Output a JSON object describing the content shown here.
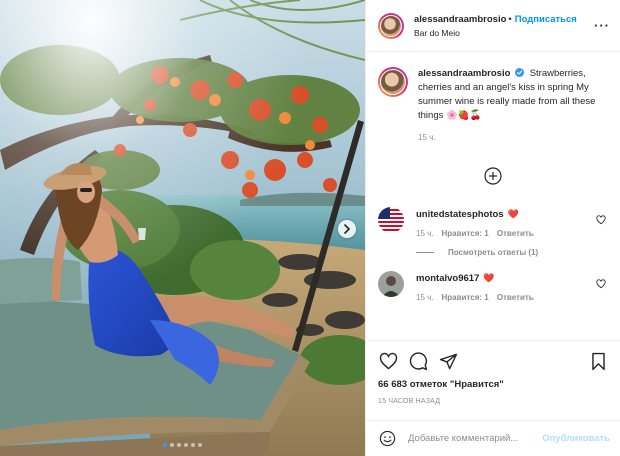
{
  "header": {
    "username": "alessandraambrosio",
    "follow_dot": "•",
    "follow_label": "Подписаться",
    "location": "Bar do Meio"
  },
  "caption": {
    "username": "alessandraambrosio",
    "text": "Strawberries, cherries and an angel's kiss in spring My summer wine is really made from all these things 🌸🍓🍒",
    "time": "15 ч."
  },
  "comments": [
    {
      "username": "unitedstatesphotos",
      "emoji": "❤️",
      "time": "15 ч.",
      "likes": "Нравится: 1",
      "reply": "Ответить",
      "view_replies": "Посмотреть ответы (1)"
    },
    {
      "username": "montalvo9617",
      "emoji": "❤️",
      "time": "15 ч.",
      "likes": "Нравится: 1",
      "reply": "Ответить"
    }
  ],
  "stats": {
    "likes": "66 683 отметок \"Нравится\"",
    "time_ago": "15 ЧАСОВ НАЗАД"
  },
  "add_comment": {
    "placeholder": "Добавьте комментарий...",
    "publish_label": "Опубликовать"
  },
  "carousel": {
    "slide_count": 6,
    "active_index": 0
  },
  "colors": {
    "accent": "#0095f6",
    "publish_disabled": "#b2dffc",
    "muted": "#8e8e8e",
    "text": "#262626",
    "carousel_active_dot": "#3897f0"
  },
  "icons": {
    "more": "more-horizontal-icon",
    "verified": "verified-badge-icon",
    "load_more": "plus-circle-icon",
    "like": "heart-outline-icon",
    "comment": "comment-bubble-icon",
    "share": "paper-plane-icon",
    "save": "bookmark-icon",
    "emoji": "smiley-icon",
    "next": "chevron-right-icon"
  }
}
